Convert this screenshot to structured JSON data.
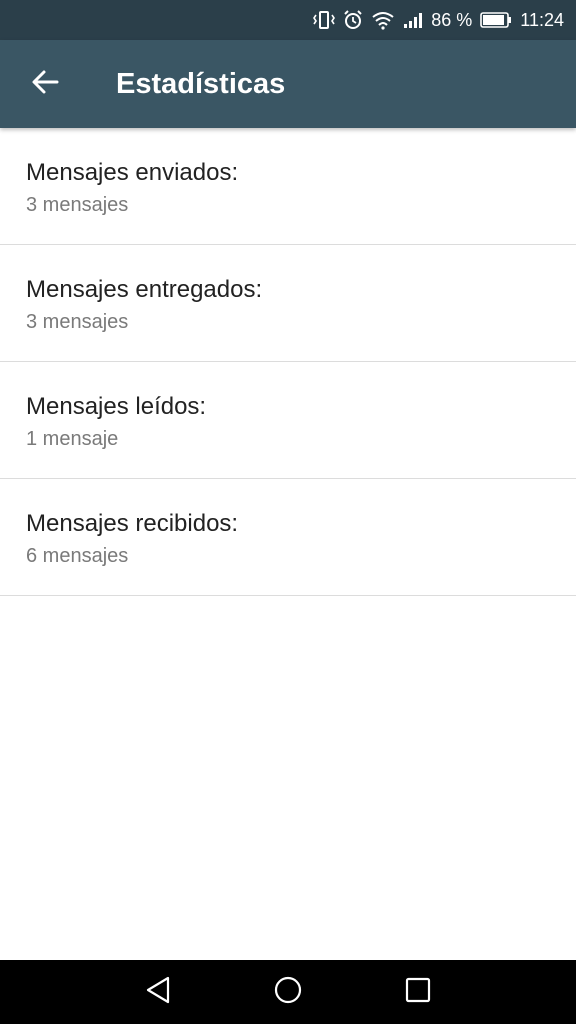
{
  "status_bar": {
    "battery_percent": "86 %",
    "time": "11:24",
    "icons": [
      "vibrate-icon",
      "alarm-icon",
      "wifi-icon",
      "signal-icon",
      "battery-icon"
    ]
  },
  "app_bar": {
    "title": "Estadísticas",
    "back_icon": "arrow-back-icon"
  },
  "stats": [
    {
      "label": "Mensajes enviados:",
      "value": "3 mensajes"
    },
    {
      "label": "Mensajes entregados:",
      "value": "3 mensajes"
    },
    {
      "label": "Mensajes leídos:",
      "value": "1 mensaje"
    },
    {
      "label": "Mensajes recibidos:",
      "value": "6 mensajes"
    }
  ],
  "nav_bar": {
    "icons": [
      "back-triangle-icon",
      "home-circle-icon",
      "recents-square-icon"
    ]
  },
  "colors": {
    "status_bar": "#2b3f4a",
    "app_bar": "#3a5664",
    "nav_bar": "#000000"
  }
}
